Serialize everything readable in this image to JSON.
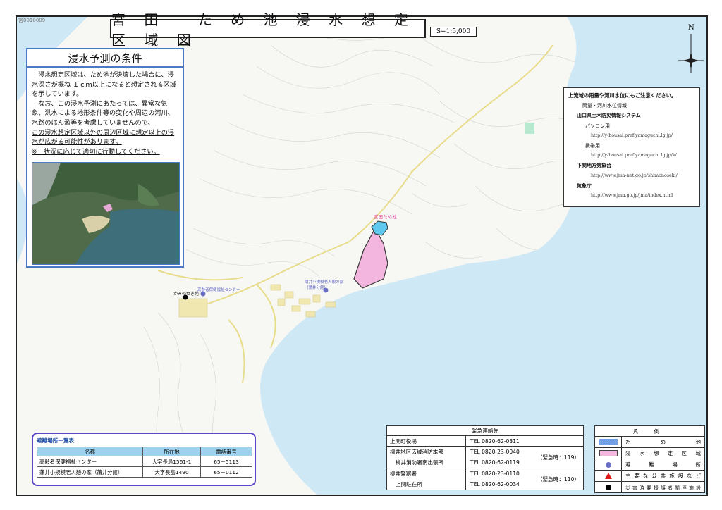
{
  "map_id": "宮0010009",
  "title": "宮 田　 た め 池 浸 水 想 定 区 域 図",
  "scale": "S=1:5,000",
  "compass": "N",
  "conditions": {
    "heading": "浸水予測の条件",
    "para1": "浸水想定区域は、ため池が決壊した場合に、浸水深さが概ね １ｃｍ以上になると想定される区域を示しています。",
    "para2": "なお、この浸水予測にあたっては、異常な気象、洪水による地形条件等の変化や周辺の河川、水路のはん濫等を考慮していませんので、",
    "para2_underlined": "この浸水想定区域以外の周辺区域に想定以上の浸水が広がる可能性があります。",
    "note": "※　状況に応じて適切に行動してください。"
  },
  "info": {
    "header": "上流域の雨量や河川水位にもご注意ください。",
    "subheader": "雨量・河川水位情報",
    "org1": "山口県土木防災情報システム",
    "pc_label": "パソコン用",
    "pc_url": "http://y-bousai.pref.yamaguchi.lg.jp/",
    "mobile_label": "携帯用",
    "mobile_url": "http://y-bousai.pref.yamaguchi.lg.jp/k/",
    "org2": "下関地方気象台",
    "org2_url": "http://www.jma-net.go.jp/shimonoseki/",
    "org3": "気象庁",
    "org3_url": "http://www.jma.go.jp/jma/index.html"
  },
  "map_labels": {
    "pond": "宮田ため池",
    "facility1": "かみのせき苑",
    "facility2": "高齢者保健福祉センター",
    "facility3": "蒲井小規模老人憩の家（蒲井分館）"
  },
  "shelters": {
    "title": "避難場所一覧表",
    "headers": [
      "名称",
      "所在地",
      "電話番号"
    ],
    "rows": [
      [
        "高齢者保健福祉センター",
        "大字長島1561-1",
        "65－5113"
      ],
      [
        "蒲井小規模老人憩の家（蒲井分館）",
        "大字長島1490",
        "65－0112"
      ]
    ]
  },
  "emergency": {
    "title": "緊急連絡先",
    "rows": [
      {
        "names": [
          "上関町役場"
        ],
        "tels": [
          "TEL  0820-62-0311"
        ],
        "note": ""
      },
      {
        "names": [
          "柳井地区広域消防本部",
          "柳井消防署南出張所"
        ],
        "tels": [
          "TEL  0820-23-0040",
          "TEL  0820-62-0119"
        ],
        "note": "（緊急時：119）"
      },
      {
        "names": [
          "柳井警察署",
          "上関駐在所"
        ],
        "tels": [
          "TEL  0820-23-0110",
          "TEL  0820-62-0034"
        ],
        "note": "（緊急時：110）"
      }
    ]
  },
  "legend": {
    "title": "凡 例",
    "items": [
      {
        "label": "た め 池",
        "symbol": "pond",
        "color": "#6fa0e8"
      },
      {
        "label": "浸 水 想 定 区 域",
        "symbol": "flood",
        "color": "#f2b6df"
      },
      {
        "label": "避 難 場 所",
        "symbol": "shelter",
        "color": "#6b6fc4"
      },
      {
        "label": "主要な公共施設など",
        "symbol": "triangle",
        "color": "#e01a1a"
      },
      {
        "label": "災害時要援護者関連施設",
        "symbol": "dot",
        "color": "#000000"
      }
    ]
  },
  "colors": {
    "sea": "#cfe8f5",
    "land": "#f7f8f4",
    "road": "#e8dc8a",
    "flood": "#f2b6df",
    "pond": "#5ec8ee",
    "panel_border": "#4a79c8"
  }
}
